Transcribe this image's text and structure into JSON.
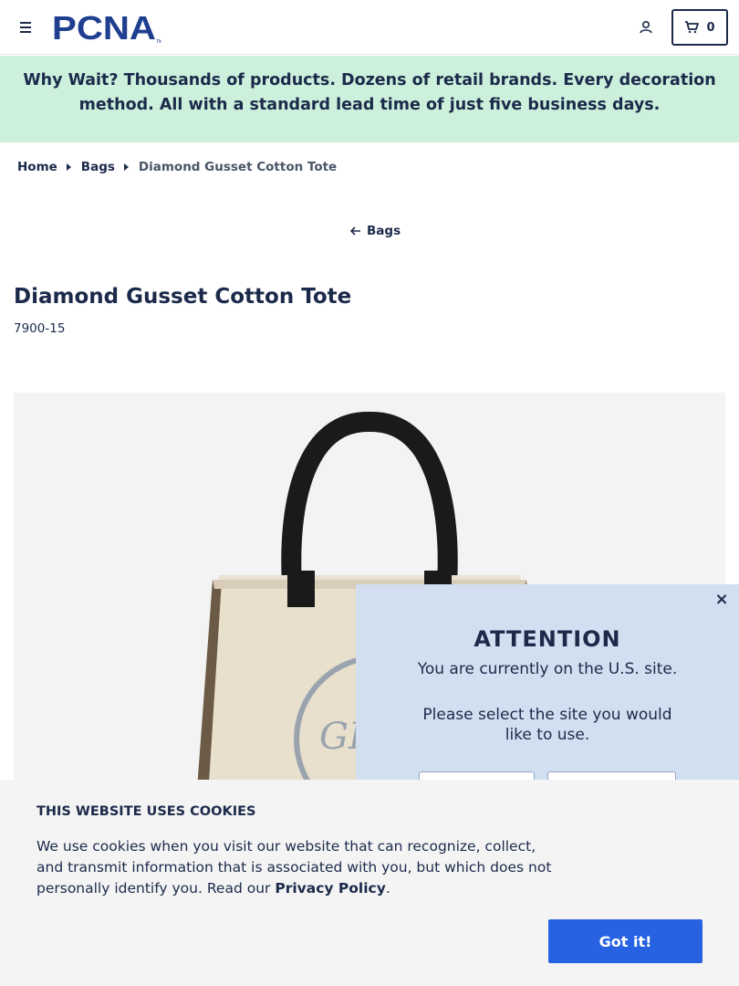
{
  "header": {
    "logo_text": "PCNA",
    "cart_count": "0"
  },
  "promo": {
    "lead": "Why Wait?",
    "text": "Thousands of products. Dozens of retail brands. Every decoration method. All with a standard lead time of just five business days."
  },
  "breadcrumb": {
    "items": [
      "Home",
      "Bags"
    ],
    "current": "Diamond Gusset Cotton Tote"
  },
  "back_link": "Bags",
  "product": {
    "title": "Diamond Gusset Cotton Tote",
    "sku": "7900-15"
  },
  "modal": {
    "close": "×",
    "title": "ATTENTION",
    "line1": "You are currently on the U.S. site.",
    "line2": "Please select the site you would like to use."
  },
  "cookie": {
    "title": "THIS WEBSITE USES COOKIES",
    "text": "We use cookies when you visit our website that can recognize, collect, and transmit information that is associated with you, but which does not personally identify you. Read our ",
    "link": "Privacy Policy",
    "period": ".",
    "button": "Got it!"
  },
  "colors": {
    "navy": "#1b2a4a",
    "promo_bg": "#cdf0dc",
    "modal_bg": "#d2dff1",
    "button_blue": "#2762e3"
  }
}
